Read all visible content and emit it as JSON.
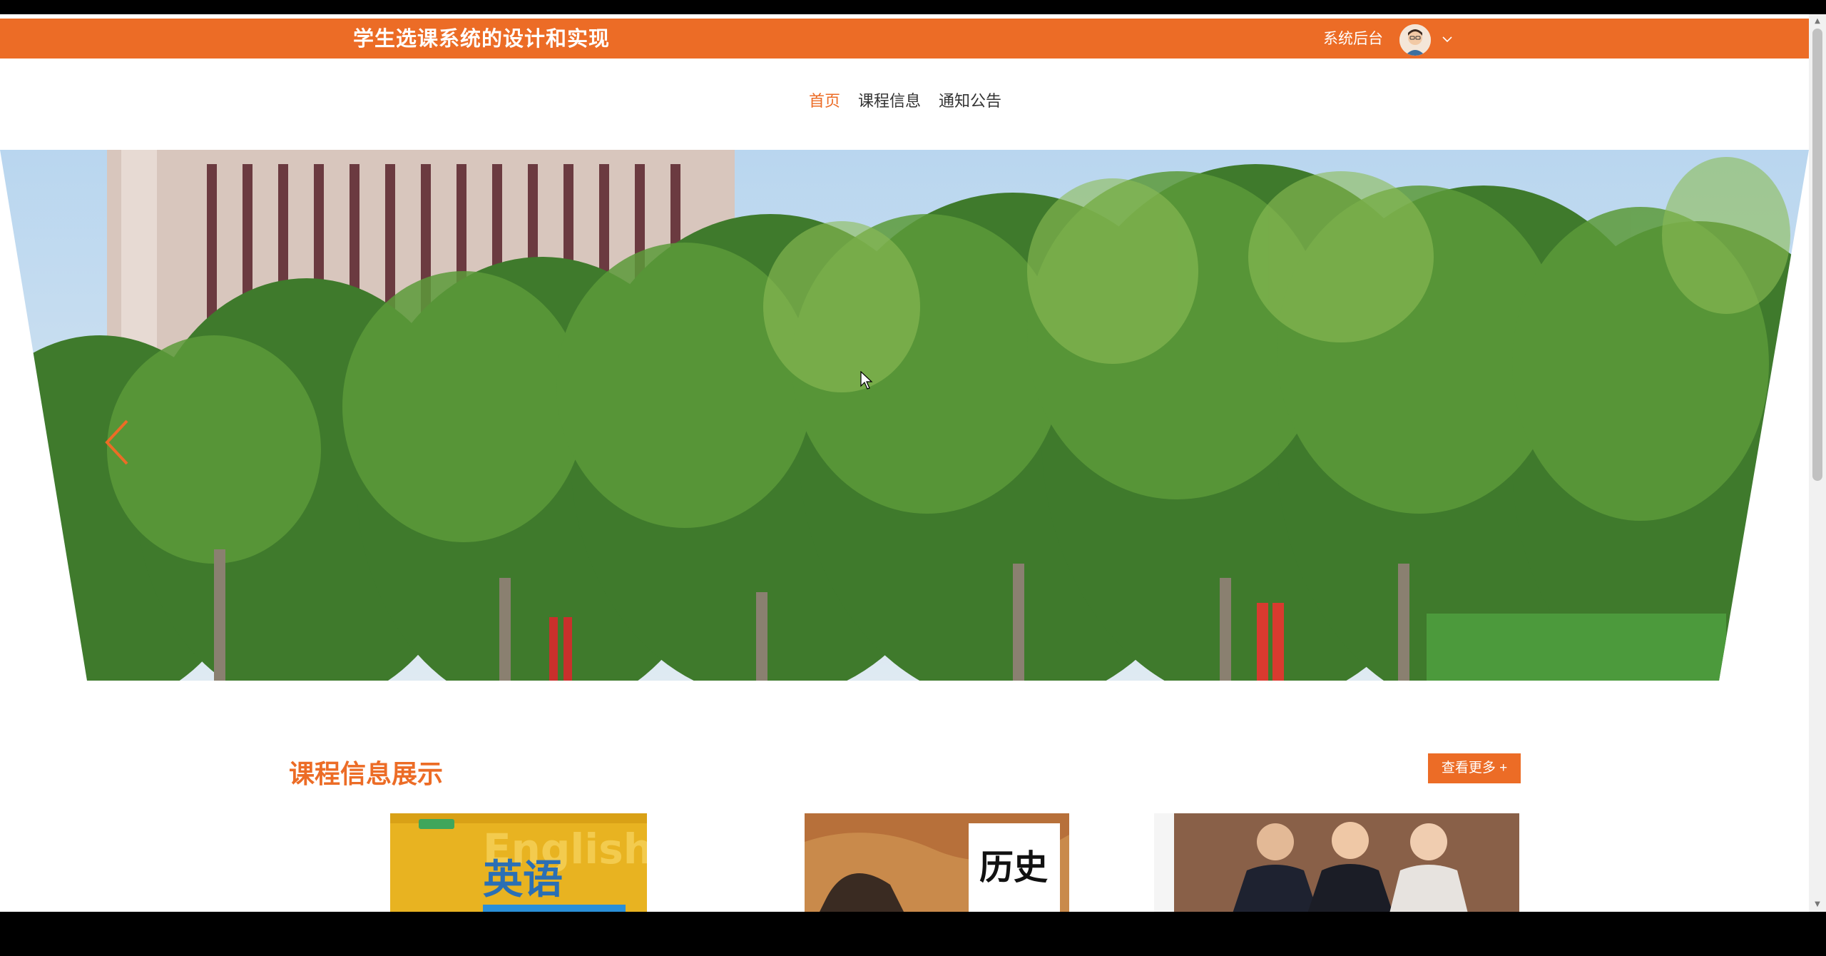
{
  "header": {
    "title": "学生选课系统的设计和实现",
    "admin_link": "系统后台",
    "avatar_icon": "user-avatar-icon",
    "dropdown_icon": "chevron-down-icon"
  },
  "nav": {
    "items": [
      {
        "label": "首页",
        "active": true
      },
      {
        "label": "课程信息",
        "active": false
      },
      {
        "label": "通知公告",
        "active": false
      }
    ]
  },
  "carousel": {
    "prev_icon": "chevron-left-icon"
  },
  "courses_section": {
    "title": "课程信息展示",
    "more_label": "查看更多 +",
    "cards": [
      {
        "image_text": "English",
        "image_title": "英语"
      },
      {
        "image_title": "历史"
      },
      {
        "image_title": ""
      }
    ]
  },
  "colors": {
    "accent": "#ec6c26"
  }
}
